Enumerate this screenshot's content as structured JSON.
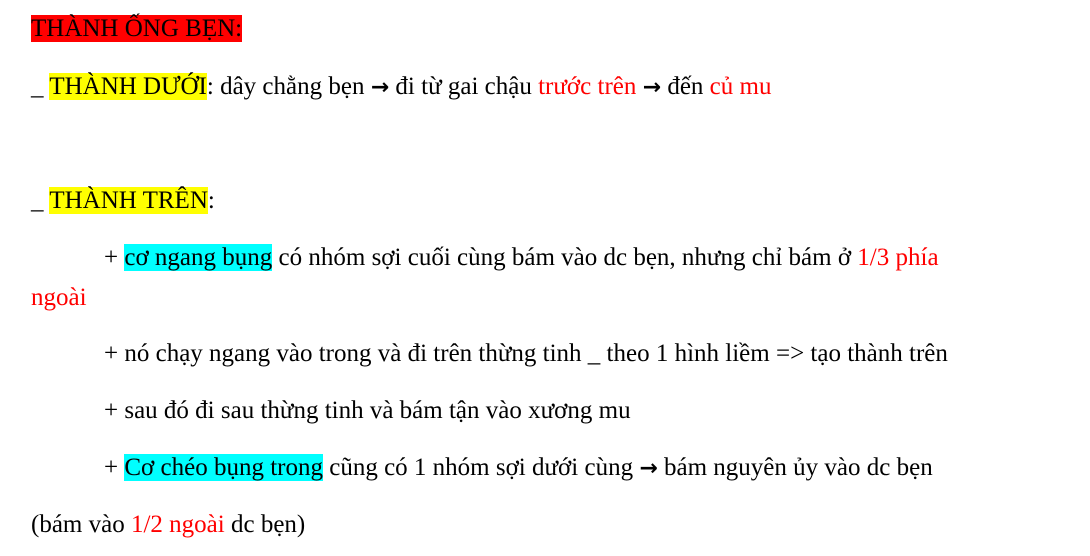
{
  "colors": {
    "red_text": "#ff0000",
    "highlight_red": "#ff0000",
    "highlight_yellow": "#ffff00",
    "highlight_cyan": "#00ffff"
  },
  "heading": "THÀNH ỐNG BẸN:",
  "thanh_duoi": {
    "prefix": "_ ",
    "label": "THÀNH DƯỚI",
    "text1": ": dây chằng bẹn ",
    "arrow1": "→",
    "text2": " đi từ gai chậu ",
    "red1": "trước trên",
    "text3": " ",
    "arrow2": "→",
    "text4": " đến ",
    "red2": "củ mu"
  },
  "thanh_tren": {
    "prefix": "_ ",
    "label": "THÀNH TRÊN",
    "colon": ":"
  },
  "bullet1": {
    "plus": "+ ",
    "highlight": "cơ ngang bụng",
    "text": " có nhóm sợi cuối cùng bám vào dc bẹn, nhưng chỉ bám ở ",
    "red_a": "1/3 phía",
    "red_b": "ngoài"
  },
  "bullet2": {
    "text": "+ nó chạy ngang vào trong và đi trên thừng tinh _ theo 1 hình liềm => tạo thành trên"
  },
  "bullet3": {
    "text": "+ sau đó đi sau thừng tinh và bám tận vào xương mu"
  },
  "bullet4": {
    "plus": "+ ",
    "highlight": "Cơ chéo bụng trong",
    "text1": " cũng có 1 nhóm sợi dưới cùng ",
    "arrow": "→",
    "text2": " bám nguyên ủy vào dc bẹn",
    "cont_text1": "(bám vào ",
    "cont_red": "1/2 ngoài",
    "cont_text2": " dc bẹn)"
  }
}
